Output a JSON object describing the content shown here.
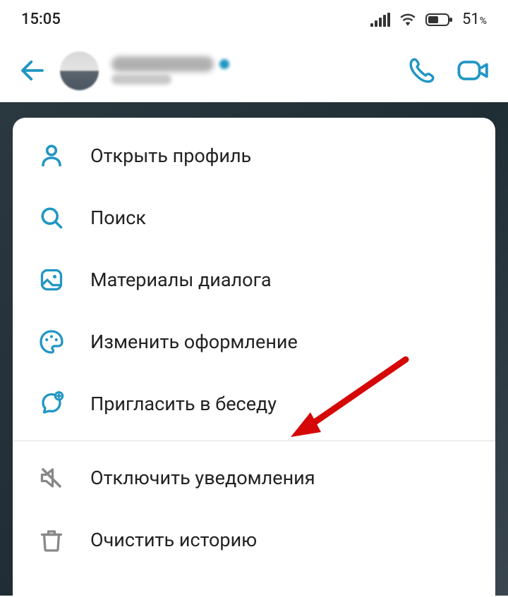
{
  "status": {
    "time": "15:05",
    "battery_percent": "51"
  },
  "colors": {
    "accent": "#2196c4",
    "text": "#222",
    "muted_icon": "#888",
    "annotation": "#d60707"
  },
  "menu": {
    "items": [
      {
        "icon": "person-icon",
        "label": "Открыть профиль"
      },
      {
        "icon": "search-icon",
        "label": "Поиск"
      },
      {
        "icon": "media-icon",
        "label": "Материалы диалога"
      },
      {
        "icon": "palette-icon",
        "label": "Изменить оформление"
      },
      {
        "icon": "invite-icon",
        "label": "Пригласить в беседу"
      }
    ],
    "items2": [
      {
        "icon": "mute-icon",
        "label": "Отключить уведомления"
      },
      {
        "icon": "trash-icon",
        "label": "Очистить историю"
      }
    ]
  }
}
